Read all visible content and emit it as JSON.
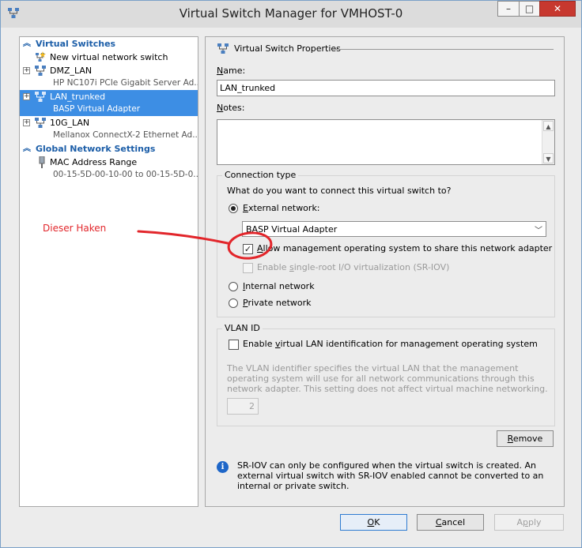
{
  "window": {
    "title": "Virtual Switch Manager for VMHOST-0",
    "minimize_glyph": "–",
    "maximize_glyph": "□",
    "close_glyph": "✕"
  },
  "left_pane": {
    "sections": [
      {
        "title": "Virtual Switches",
        "items": [
          {
            "label": "New virtual network switch",
            "sub": "",
            "icon": "new-switch-icon",
            "expandable": false,
            "selected": false
          },
          {
            "label": "DMZ_LAN",
            "sub": "HP NC107i PCIe Gigabit Server Ad...",
            "icon": "network-switch-icon",
            "expandable": true,
            "selected": false
          },
          {
            "label": "LAN_trunked",
            "sub": "BASP Virtual Adapter",
            "icon": "network-switch-icon",
            "expandable": true,
            "selected": true
          },
          {
            "label": "10G_LAN",
            "sub": "Mellanox ConnectX-2 Ethernet Ad...",
            "icon": "network-switch-icon",
            "expandable": true,
            "selected": false
          }
        ]
      },
      {
        "title": "Global Network Settings",
        "items": [
          {
            "label": "MAC Address Range",
            "sub": "00-15-5D-00-10-00 to 00-15-5D-0...",
            "icon": "mac-address-icon",
            "expandable": false,
            "selected": false
          }
        ]
      }
    ]
  },
  "properties": {
    "group_title": "Virtual Switch Properties",
    "name_label_u": "N",
    "name_label_rest": "ame:",
    "name_value": "LAN_trunked",
    "notes_label_u": "N",
    "notes_label_rest": "otes:",
    "notes_value": "",
    "connection_type": {
      "legend": "Connection type",
      "question": "What do you want to connect this virtual switch to?",
      "external_label_u": "E",
      "external_label_rest": "xternal network:",
      "external_selected": true,
      "adapter_selected": "BASP Virtual Adapter",
      "allow_mgmt_label_u": "A",
      "allow_mgmt_label_rest": "llow management operating system to share this network adapter",
      "allow_mgmt_checked": true,
      "sriov_label_pre": "Enable ",
      "sriov_label_u": "s",
      "sriov_label_rest": "ingle-root I/O virtualization (SR-IOV)",
      "sriov_checked": false,
      "internal_label_u": "I",
      "internal_label_rest": "nternal network",
      "private_label_u": "P",
      "private_label_rest": "rivate network"
    },
    "vlan": {
      "legend": "VLAN ID",
      "enable_label_pre": "Enable ",
      "enable_label_u": "v",
      "enable_label_rest": "irtual LAN identification for management operating system",
      "enable_checked": false,
      "description": "The VLAN identifier specifies the virtual LAN that the management operating system will use for all network communications through this network adapter. This setting does not affect virtual machine networking.",
      "vlan_id_value": "2"
    },
    "remove_label_u": "R",
    "remove_label_rest": "emove",
    "info_text": "SR-IOV can only be configured when the virtual switch is created. An external virtual switch with SR-IOV enabled cannot be converted to an internal or private switch."
  },
  "footer": {
    "ok_u": "O",
    "ok_rest": "K",
    "cancel_u": "C",
    "cancel_rest": "ancel",
    "apply_pre": "A",
    "apply_u": "p",
    "apply_rest": "ply"
  },
  "annotation": {
    "text": "Dieser Haken",
    "color": "#e2262b"
  },
  "colors": {
    "selection": "#3d8ee4",
    "section_header": "#1c5ea8",
    "close_button": "#c7382f"
  }
}
